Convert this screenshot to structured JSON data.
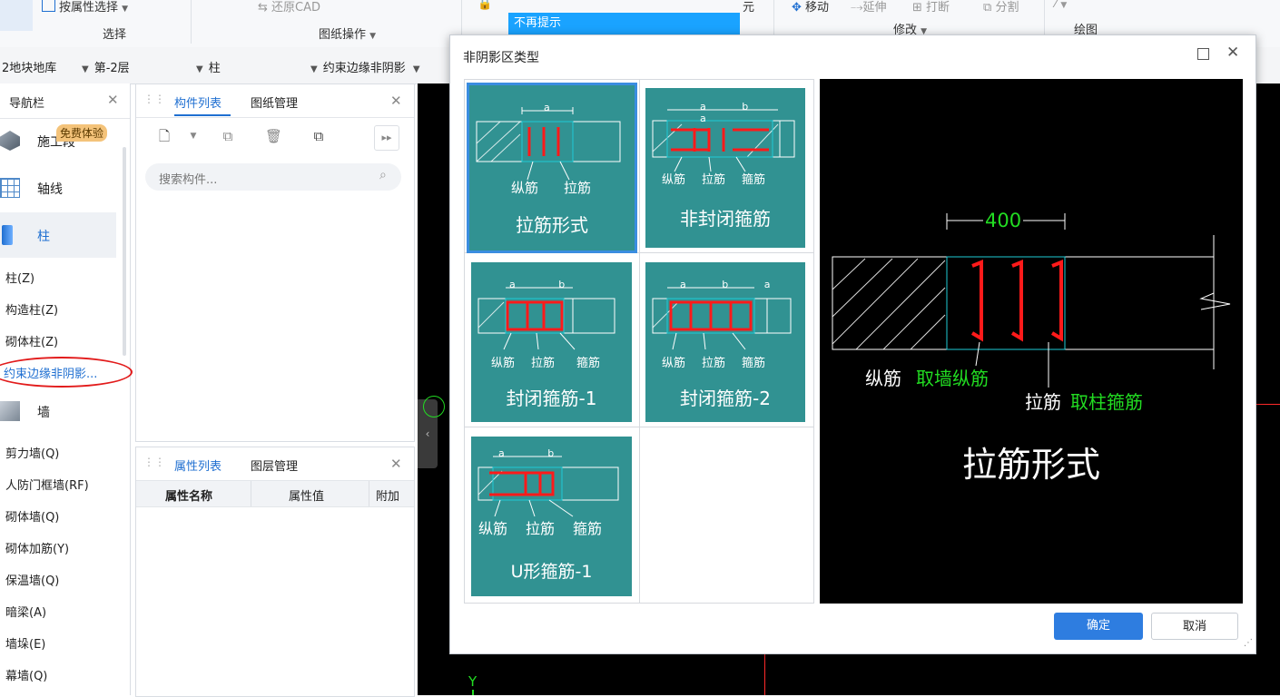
{
  "ribbon": {
    "select_by_attr": "按属性选择",
    "group_select": "选择",
    "restore_cad": "还原CAD",
    "group_drawing": "图纸操作",
    "cell_fragment": "元",
    "move": "移动",
    "extend": "延伸",
    "break": "打断",
    "split": "分割",
    "group_modify": "修改",
    "group_draw": "绘图",
    "tooltip": "不再提示"
  },
  "filterbar": {
    "project": "2地块地库",
    "floor": "第-2层",
    "category": "柱",
    "type": "约束边缘非阴影"
  },
  "nav": {
    "title": "导航栏",
    "trial_badge": "免费体验",
    "cat_construction": "施工段",
    "cat_axis": "轴线",
    "cat_column": "柱",
    "cat_wall": "墙",
    "column_items": [
      "柱(Z)",
      "构造柱(Z)",
      "砌体柱(Z)"
    ],
    "selected_item": "约束边缘非阴影...",
    "wall_items": [
      "剪力墙(Q)",
      "人防门框墙(RF)",
      "砌体墙(Q)",
      "砌体加筋(Y)",
      "保温墙(Q)",
      "暗梁(A)",
      "墙垛(E)",
      "幕墙(Q)"
    ]
  },
  "component_panel": {
    "tab_list": "构件列表",
    "tab_drawings": "图纸管理",
    "search_placeholder": "搜索构件..."
  },
  "property_panel": {
    "tab_props": "属性列表",
    "tab_layers": "图层管理",
    "col_name": "属性名称",
    "col_value": "属性值",
    "col_extra": "附加"
  },
  "canvas": {
    "axis_y": "Y"
  },
  "dialog": {
    "title": "非阴影区类型",
    "confirm": "确定",
    "cancel": "取消",
    "cards": [
      {
        "title": "拉筋形式",
        "dims": "a",
        "labels": [
          "纵筋",
          "拉筋"
        ]
      },
      {
        "title": "非封闭箍筋",
        "dims": "a b a",
        "labels": [
          "纵筋",
          "拉筋",
          "箍筋"
        ]
      },
      {
        "title": "封闭箍筋-1",
        "dims": "a b",
        "labels": [
          "纵筋",
          "拉筋",
          "箍筋"
        ]
      },
      {
        "title": "封闭箍筋-2",
        "dims": "a b a",
        "labels": [
          "纵筋",
          "拉筋",
          "箍筋"
        ]
      },
      {
        "title": "U形箍筋-1",
        "dims": "a b",
        "labels": [
          "纵筋",
          "拉筋",
          "箍筋"
        ]
      }
    ],
    "preview": {
      "dimension": "400",
      "label_long": "纵筋",
      "label_long_src": "取墙纵筋",
      "label_tie": "拉筋",
      "label_tie_src": "取柱箍筋",
      "title": "拉筋形式"
    }
  },
  "colors": {
    "accent": "#1f6fd1",
    "card_bg": "#319292",
    "rebar": "#ff1a1a",
    "cad_green": "#22dd22",
    "cad_cyan": "#1ecbd6",
    "tooltip_bg": "#1aa3ff",
    "badge_bg": "#f4c37a"
  }
}
